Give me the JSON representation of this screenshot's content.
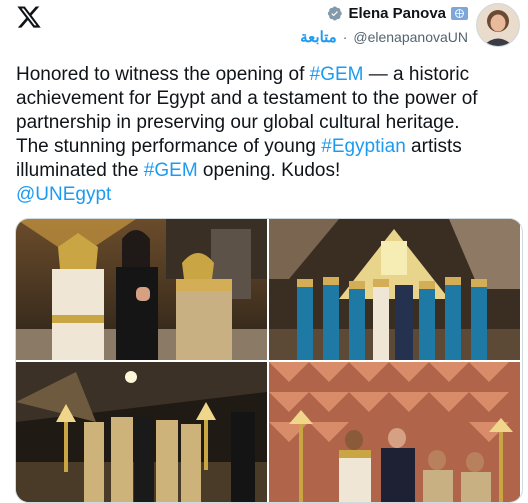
{
  "author": {
    "display_name": "Elena Panova",
    "handle": "@elenapanovaUN",
    "follow_label": "متابعة",
    "separator": "·"
  },
  "icons": {
    "logo": "x-logo-icon",
    "verified": "verified-check-icon",
    "affiliation": "un-affiliate-badge-icon"
  },
  "colors": {
    "link": "#1d9bf0",
    "text": "#0f1419",
    "muted": "#536471"
  },
  "tweet": {
    "line1_pre": "Honored to witness the opening of ",
    "hashtag_gem": "#GEM",
    "line1_post": " — a historic achievement for Egypt and a testament to the power of partnership in preserving our global cultural heritage.",
    "line2_pre": "The stunning performance of young ",
    "hashtag_egyptian": "#Egyptian",
    "line2_mid": " artists illuminated the ",
    "hashtag_gem2": "#GEM",
    "line2_post": " opening. Kudos!",
    "mention": "@UNEgypt"
  }
}
